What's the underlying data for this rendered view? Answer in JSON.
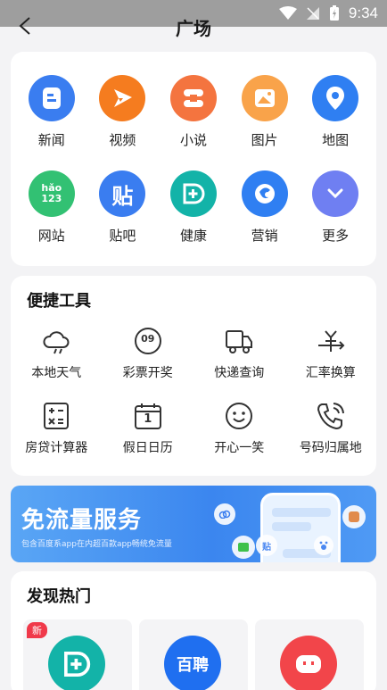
{
  "status_bar": {
    "time": "9:34"
  },
  "header": {
    "title": "广场"
  },
  "apps": [
    {
      "label": "新闻",
      "icon": "news-icon",
      "color": "#3a7df0"
    },
    {
      "label": "视频",
      "icon": "video-play-icon",
      "color": "#f57c1f"
    },
    {
      "label": "小说",
      "icon": "novel-icon",
      "color": "#f4743f"
    },
    {
      "label": "图片",
      "icon": "image-icon",
      "color": "#f9a34a"
    },
    {
      "label": "地图",
      "icon": "map-pin-icon",
      "color": "#2f7ff2"
    },
    {
      "label": "网站",
      "icon": "hao123-icon",
      "color": "#32c173",
      "icon_text": "hǎo\n123"
    },
    {
      "label": "贴吧",
      "icon": "tieba-icon",
      "color": "#3a7df0",
      "icon_text": "贴"
    },
    {
      "label": "健康",
      "icon": "health-icon",
      "color": "#13b3a8"
    },
    {
      "label": "营销",
      "icon": "marketing-icon",
      "color": "#2f7ff2"
    },
    {
      "label": "更多",
      "icon": "chevron-down-icon",
      "color": "#6f7ff2"
    }
  ],
  "tools": {
    "title": "便捷工具",
    "items": [
      {
        "label": "本地天气",
        "icon": "weather-icon"
      },
      {
        "label": "彩票开奖",
        "icon": "lottery-icon",
        "icon_text": "09"
      },
      {
        "label": "快递查询",
        "icon": "delivery-truck-icon"
      },
      {
        "label": "汇率换算",
        "icon": "currency-exchange-icon"
      },
      {
        "label": "房贷计算器",
        "icon": "calculator-icon"
      },
      {
        "label": "假日日历",
        "icon": "calendar-icon",
        "icon_text": "1"
      },
      {
        "label": "开心一笑",
        "icon": "smile-icon"
      },
      {
        "label": "号码归属地",
        "icon": "phone-icon"
      }
    ]
  },
  "banner": {
    "title": "免流量服务",
    "subtitle": "包含百度系app在内超百款app畅统免流量",
    "phone_badge": "贴"
  },
  "discover": {
    "title": "发现热门",
    "new_badge": "新",
    "items": [
      {
        "icon": "health-icon",
        "color": "#13b3a8"
      },
      {
        "icon": "baipin-icon",
        "color": "#1f6ff0",
        "icon_text": "百聘"
      },
      {
        "icon": "robot-icon",
        "color": "#f2454a"
      }
    ]
  }
}
